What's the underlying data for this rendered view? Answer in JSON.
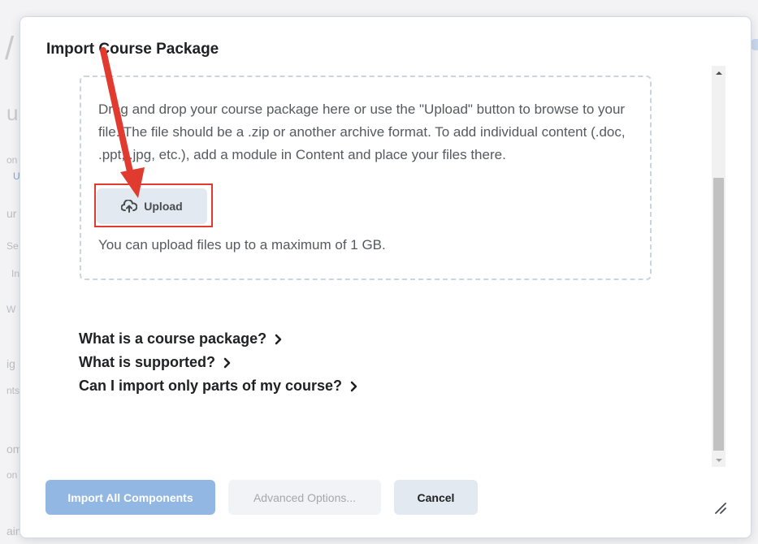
{
  "background": {
    "fragments": [
      "/",
      "u",
      "on",
      "U",
      "ur",
      "Se",
      "In",
      "W",
      "ig",
      "nts",
      "om",
      "on",
      "ain"
    ]
  },
  "dialog": {
    "title": "Import Course Package",
    "drop_zone": {
      "instructions": "Drag and drop your course package here or use the \"Upload\" button to browse to your file. The file should be a .zip or another archive format. To add individual content (.doc, .ppt, .jpg, etc.), add a module in Content and place your files there.",
      "upload_label": "Upload",
      "upload_icon": "cloud-upload-icon",
      "limit_text": "You can upload files up to a maximum of 1 GB."
    },
    "help_links": [
      {
        "label": "What is a course package?"
      },
      {
        "label": "What is supported?"
      },
      {
        "label": "Can I import only parts of my course?"
      }
    ],
    "footer": {
      "import_all_label": "Import All Components",
      "advanced_label": "Advanced Options...",
      "cancel_label": "Cancel"
    }
  },
  "annotation": {
    "highlight_color": "#e13b30",
    "arrow_color": "#e13b30"
  },
  "colors": {
    "primary_disabled": "#93b7e3",
    "secondary_button": "#e3e9f1",
    "text_dark": "#202122"
  }
}
